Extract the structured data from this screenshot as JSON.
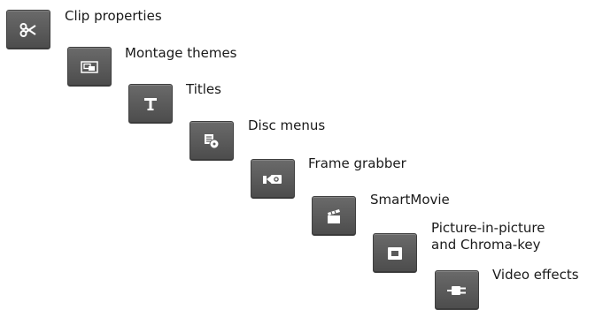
{
  "tools": [
    {
      "label": "Clip properties",
      "icon": "scissors-icon"
    },
    {
      "label": "Montage themes",
      "icon": "montage-icon"
    },
    {
      "label": "Titles",
      "icon": "title-icon"
    },
    {
      "label": "Disc menus",
      "icon": "disc-menu-icon"
    },
    {
      "label": "Frame grabber",
      "icon": "camera-icon"
    },
    {
      "label": "SmartMovie",
      "icon": "clapperboard-icon"
    },
    {
      "label": "Picture-in-picture\nand Chroma-key",
      "icon": "pip-icon"
    },
    {
      "label": "Video effects",
      "icon": "plug-icon"
    }
  ]
}
